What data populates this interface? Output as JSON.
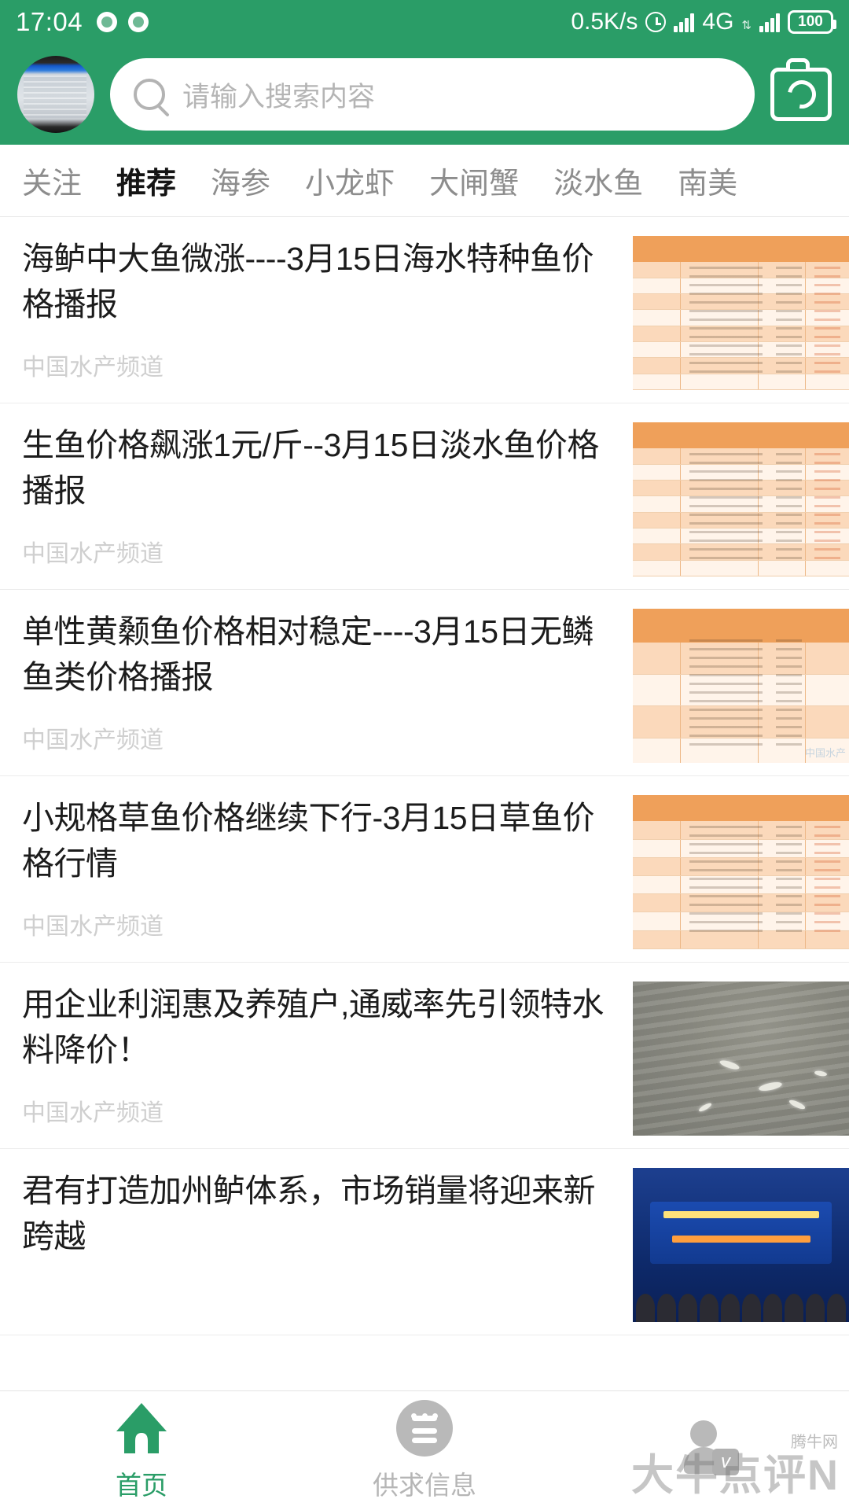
{
  "status_bar": {
    "time": "17:04",
    "network_speed": "0.5K/s",
    "network_type": "4G",
    "battery": "100",
    "alarm_icon": "alarm-clock-icon",
    "signal_icon": "signal-bars-icon"
  },
  "header": {
    "avatar_name": "user-avatar",
    "search_placeholder": "请输入搜索内容",
    "search_value": "",
    "search_icon": "search-icon",
    "camera_icon": "camera-icon"
  },
  "tabs": {
    "items": [
      {
        "label": "关注",
        "active": false
      },
      {
        "label": "推荐",
        "active": true
      },
      {
        "label": "海参",
        "active": false
      },
      {
        "label": "小龙虾",
        "active": false
      },
      {
        "label": "大闸蟹",
        "active": false
      },
      {
        "label": "淡水鱼",
        "active": false
      },
      {
        "label": "南美",
        "active": false
      }
    ]
  },
  "articles": [
    {
      "title": "海鲈中大鱼微涨----3月15日海水特种鱼价格播报",
      "source": "中国水产频道",
      "thumb_type": "price-table"
    },
    {
      "title": "生鱼价格飙涨1元/斤--3月15日淡水鱼价格播报",
      "source": "中国水产频道",
      "thumb_type": "price-table"
    },
    {
      "title": "单性黄颡鱼价格相对稳定----3月15日无鳞鱼类价格播报",
      "source": "中国水产频道",
      "thumb_type": "price-table-large"
    },
    {
      "title": "小规格草鱼价格继续下行-3月15日草鱼价格行情",
      "source": "中国水产频道",
      "thumb_type": "price-table"
    },
    {
      "title": "用企业利润惠及养殖户,通威率先引领特水料降价！",
      "source": "中国水产频道",
      "thumb_type": "photo-water"
    },
    {
      "title": "君有打造加州鲈体系，市场销量将迎来新跨越",
      "source": "",
      "thumb_type": "photo-stage"
    }
  ],
  "bottom_nav": {
    "items": [
      {
        "label": "首页",
        "icon": "home-icon",
        "active": true
      },
      {
        "label": "供求信息",
        "icon": "info-circle-icon",
        "active": false
      },
      {
        "label": "",
        "icon": "user-account-icon",
        "active": false
      }
    ]
  },
  "watermark": {
    "main": "大牛点评N",
    "sub": "腾牛网",
    "thumb_tag": "中国水产"
  },
  "colors": {
    "brand_green": "#2a9d67",
    "table_orange": "#efa05a",
    "table_row": "#fbd9bb",
    "muted_text": "#cfcfcf"
  }
}
